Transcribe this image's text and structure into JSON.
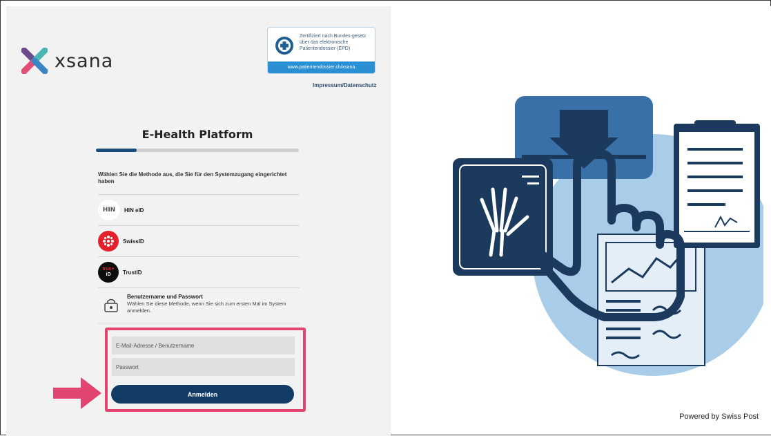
{
  "brand": {
    "name": "xsana"
  },
  "certificate": {
    "text": "Zertifiziert nach Bundes-gesetz über das elektronische Patientendossier (EPD)",
    "link": "www.patientendossier.ch/xsana"
  },
  "header": {
    "impressum_link": "Impressum/Datenschutz"
  },
  "main": {
    "title": "E-Health Platform",
    "progress": 0.2,
    "instruction": "Wählen Sie die Methode aus, die Sie für den Systemzugang eingerichtet haben"
  },
  "methods": [
    {
      "label": "HIN eID",
      "icon": "hin-logo"
    },
    {
      "label": "SwissID",
      "icon": "swissid-logo"
    },
    {
      "label": "TrustID",
      "icon": "trustid-logo",
      "logo_text_top": "trus+",
      "logo_text_bottom": "iD"
    }
  ],
  "password_method": {
    "title": "Benutzername und Passwort",
    "description": "Wählen Sie diese Methode, wenn Sie sich zum ersten Mal im System anmelden."
  },
  "login": {
    "email_placeholder": "E-Mail-Adresse / Benutzername",
    "password_placeholder": "Passwort",
    "submit_label": "Anmelden"
  },
  "footer": {
    "powered_by": "Powered by Swiss Post"
  },
  "colors": {
    "accent": "#123c66",
    "highlight": "#e1446f",
    "illustration_navy": "#1c3a5e",
    "illustration_light": "#a9cde9"
  }
}
